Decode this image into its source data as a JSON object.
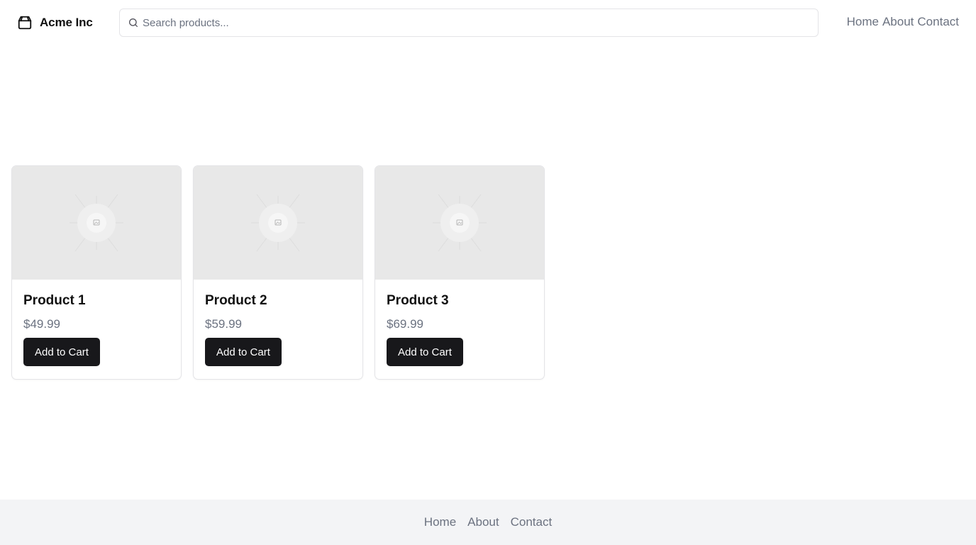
{
  "header": {
    "brand": {
      "name": "Acme Inc",
      "icon": "bag-icon"
    },
    "search": {
      "placeholder": "Search products...",
      "value": "",
      "icon": "search-icon"
    },
    "nav": [
      {
        "label": "Home"
      },
      {
        "label": "About"
      },
      {
        "label": "Contact"
      }
    ]
  },
  "products": [
    {
      "name": "Product 1",
      "price": "$49.99",
      "button": "Add to Cart",
      "image": "image-placeholder-icon"
    },
    {
      "name": "Product 2",
      "price": "$59.99",
      "button": "Add to Cart",
      "image": "image-placeholder-icon"
    },
    {
      "name": "Product 3",
      "price": "$69.99",
      "button": "Add to Cart",
      "image": "image-placeholder-icon"
    }
  ],
  "footer": {
    "nav": [
      {
        "label": "Home"
      },
      {
        "label": "About"
      },
      {
        "label": "Contact"
      }
    ]
  },
  "colors": {
    "text": "#111111",
    "muted": "#6b7280",
    "button_bg": "#18181b",
    "button_text": "#ffffff",
    "border": "#e4e4e7",
    "image_bg": "#e8e8e8",
    "footer_bg": "#f3f4f6"
  }
}
